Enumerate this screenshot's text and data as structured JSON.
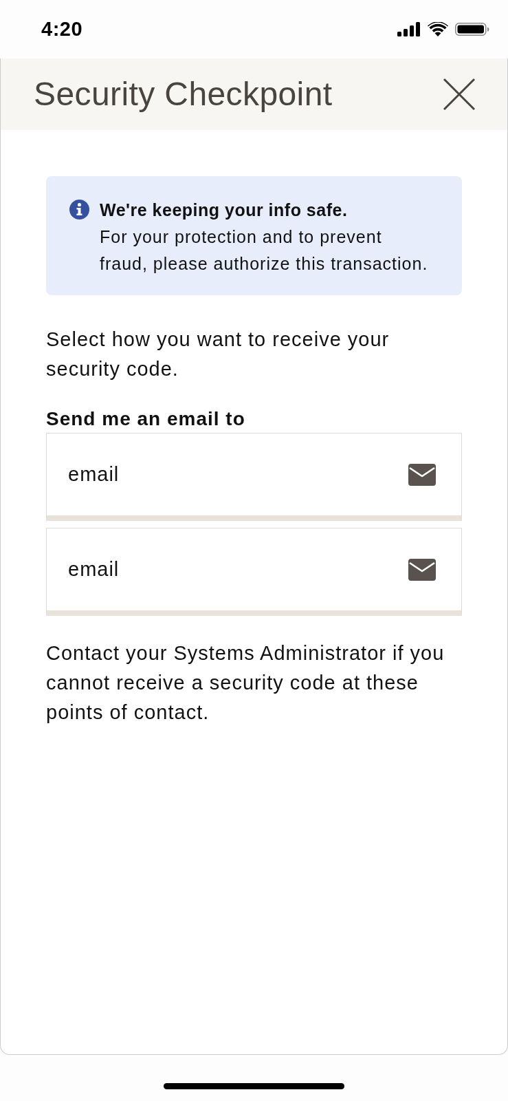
{
  "status_bar": {
    "time": "4:20"
  },
  "header": {
    "title": "Security Checkpoint"
  },
  "alert": {
    "title": "We're keeping your info safe.",
    "text": "For your protection and to prevent fraud, please authorize this transaction."
  },
  "instruction": "Select how you want to receive your security code.",
  "section_label": "Send me an email to",
  "options": [
    {
      "label": "email"
    },
    {
      "label": "email"
    }
  ],
  "footer_note": "Contact your Systems Administrator if you cannot receive a security code at these points of contact."
}
